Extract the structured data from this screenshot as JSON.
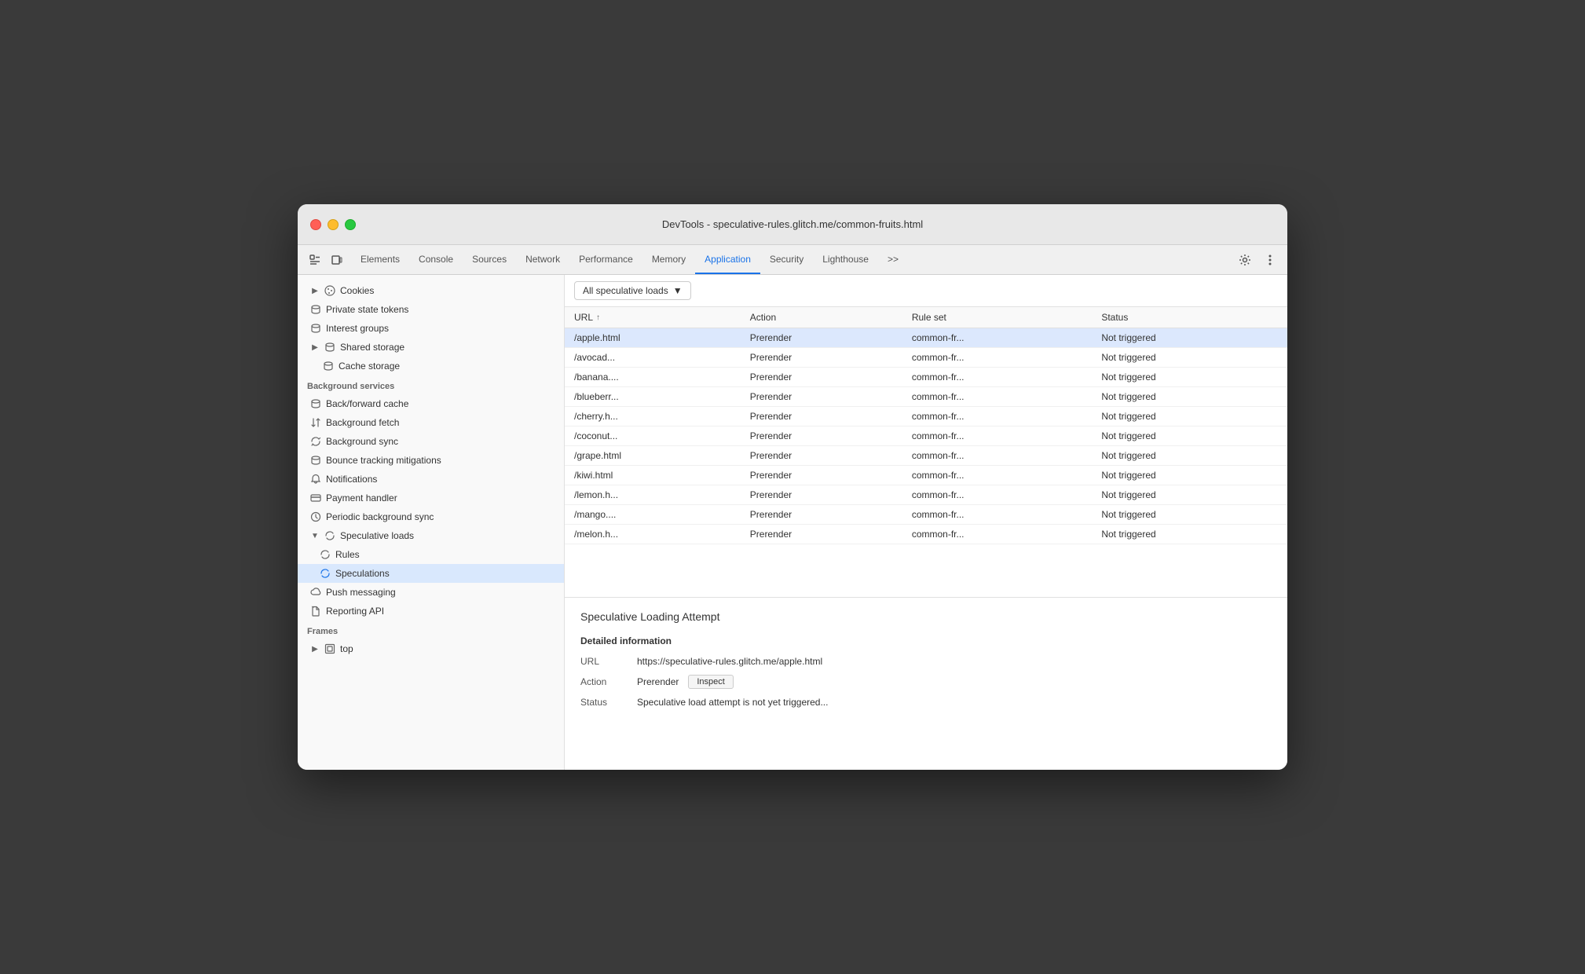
{
  "window": {
    "title": "DevTools - speculative-rules.glitch.me/common-fruits.html"
  },
  "titlebar": {
    "traffic_lights": [
      "red",
      "yellow",
      "green"
    ]
  },
  "tabs": {
    "items": [
      {
        "label": "Elements",
        "active": false
      },
      {
        "label": "Console",
        "active": false
      },
      {
        "label": "Sources",
        "active": false
      },
      {
        "label": "Network",
        "active": false
      },
      {
        "label": "Performance",
        "active": false
      },
      {
        "label": "Memory",
        "active": false
      },
      {
        "label": "Application",
        "active": true
      },
      {
        "label": "Security",
        "active": false
      },
      {
        "label": "Lighthouse",
        "active": false
      },
      {
        "label": ">>",
        "active": false
      }
    ]
  },
  "sidebar": {
    "sections": [
      {
        "items": [
          {
            "label": "Cookies",
            "icon": "cookie",
            "indent": 1,
            "has_chevron": true,
            "chevron_dir": "right"
          },
          {
            "label": "Private state tokens",
            "icon": "db",
            "indent": 0
          },
          {
            "label": "Interest groups",
            "icon": "db",
            "indent": 0
          },
          {
            "label": "Shared storage",
            "icon": "db",
            "indent": 1,
            "has_chevron": true,
            "chevron_dir": "right"
          },
          {
            "label": "Cache storage",
            "icon": "db",
            "indent": 1,
            "has_chevron": false
          }
        ]
      },
      {
        "header": "Background services",
        "items": [
          {
            "label": "Back/forward cache",
            "icon": "db",
            "indent": 0
          },
          {
            "label": "Background fetch",
            "icon": "arrow-down-up",
            "indent": 0
          },
          {
            "label": "Background sync",
            "icon": "sync",
            "indent": 0
          },
          {
            "label": "Bounce tracking mitigations",
            "icon": "db",
            "indent": 0
          },
          {
            "label": "Notifications",
            "icon": "bell",
            "indent": 0
          },
          {
            "label": "Payment handler",
            "icon": "card",
            "indent": 0
          },
          {
            "label": "Periodic background sync",
            "icon": "clock",
            "indent": 0
          },
          {
            "label": "Speculative loads",
            "icon": "sync",
            "indent": 0,
            "has_chevron": true,
            "chevron_dir": "down",
            "expanded": true
          },
          {
            "label": "Rules",
            "icon": "sync",
            "indent": 1
          },
          {
            "label": "Speculations",
            "icon": "sync",
            "indent": 1,
            "active": true
          },
          {
            "label": "Push messaging",
            "icon": "cloud",
            "indent": 0
          },
          {
            "label": "Reporting API",
            "icon": "file",
            "indent": 0
          }
        ]
      },
      {
        "header": "Frames",
        "items": [
          {
            "label": "top",
            "icon": "frame",
            "indent": 0,
            "has_chevron": true,
            "chevron_dir": "right"
          }
        ]
      }
    ]
  },
  "filter": {
    "label": "All speculative loads",
    "dropdown_icon": "▼"
  },
  "table": {
    "columns": [
      "URL",
      "Action",
      "Rule set",
      "Status"
    ],
    "rows": [
      {
        "url": "/apple.html",
        "action": "Prerender",
        "rule_set": "common-fr...",
        "status": "Not triggered",
        "selected": true
      },
      {
        "url": "/avocad...",
        "action": "Prerender",
        "rule_set": "common-fr...",
        "status": "Not triggered",
        "selected": false
      },
      {
        "url": "/banana....",
        "action": "Prerender",
        "rule_set": "common-fr...",
        "status": "Not triggered",
        "selected": false
      },
      {
        "url": "/blueberr...",
        "action": "Prerender",
        "rule_set": "common-fr...",
        "status": "Not triggered",
        "selected": false
      },
      {
        "url": "/cherry.h...",
        "action": "Prerender",
        "rule_set": "common-fr...",
        "status": "Not triggered",
        "selected": false
      },
      {
        "url": "/coconut...",
        "action": "Prerender",
        "rule_set": "common-fr...",
        "status": "Not triggered",
        "selected": false
      },
      {
        "url": "/grape.html",
        "action": "Prerender",
        "rule_set": "common-fr...",
        "status": "Not triggered",
        "selected": false
      },
      {
        "url": "/kiwi.html",
        "action": "Prerender",
        "rule_set": "common-fr...",
        "status": "Not triggered",
        "selected": false
      },
      {
        "url": "/lemon.h...",
        "action": "Prerender",
        "rule_set": "common-fr...",
        "status": "Not triggered",
        "selected": false
      },
      {
        "url": "/mango....",
        "action": "Prerender",
        "rule_set": "common-fr...",
        "status": "Not triggered",
        "selected": false
      },
      {
        "url": "/melon.h...",
        "action": "Prerender",
        "rule_set": "common-fr...",
        "status": "Not triggered",
        "selected": false
      }
    ]
  },
  "detail": {
    "title": "Speculative Loading Attempt",
    "section_title": "Detailed information",
    "url_label": "URL",
    "url_value": "https://speculative-rules.glitch.me/apple.html",
    "action_label": "Action",
    "action_value": "Prerender",
    "inspect_label": "Inspect",
    "status_label": "Status",
    "status_value": "Speculative load attempt is not yet triggered..."
  }
}
